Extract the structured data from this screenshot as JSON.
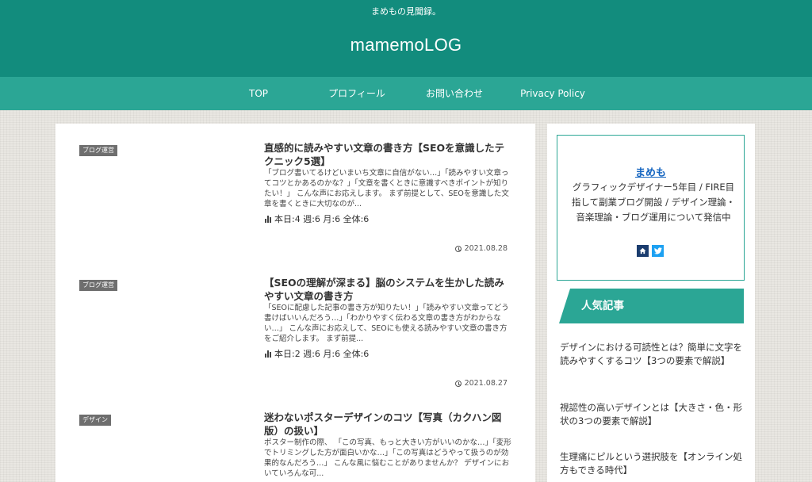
{
  "header": {
    "tagline": "まめもの見聞録。",
    "site_title": "mamemoLOG"
  },
  "nav": {
    "items": [
      {
        "label": "TOP"
      },
      {
        "label": "プロフィール"
      },
      {
        "label": "お問い合わせ"
      },
      {
        "label": "Privacy Policy"
      }
    ]
  },
  "articles": [
    {
      "category": "ブログ運営",
      "title": "直感的に読みやすい文章の書き方【SEOを意識したテクニック5選】",
      "excerpt": "「ブログ書いてるけどいまいち文章に自信がない…」「読みやすい文章ってコツとかあるのかな？」「文章を書くときに意識すべきポイントが知りたい！」 こんな声にお応えします。 まず前提として、SEOを意識した文章を書くときに大切なのが...",
      "stats": "本日:4 週:6 月:6 全体:6",
      "date": "2021.08.28"
    },
    {
      "category": "ブログ運営",
      "title": "【SEOの理解が深まる】脳のシステムを生かした読みやすい文章の書き方",
      "excerpt": "「SEOに配慮した記事の書き方が知りたい！」「読みやすい文章ってどう書けばいいんだろう…」「わかりやすく伝わる文章の書き方がわからない…」 こんな声にお応えして、SEOにも使える読みやすい文章の書き方をご紹介します。 まず前提...",
      "stats": "本日:2 週:6 月:6 全体:6",
      "date": "2021.08.27"
    },
    {
      "category": "デザイン",
      "title": "迷わないポスターデザインのコツ【写真（カクハン図版）の扱い】",
      "excerpt": "ポスター制作の際、 「この写真、もっと大きい方がいいのかな…」「変形でトリミングした方が面白いかな…」「この写真はどうやって扱うのが効果的なんだろう…」 こんな風に悩むことがありませんか？ デザインにおいていろんな可...",
      "stats": "",
      "date": ""
    }
  ],
  "sidebar": {
    "profile": {
      "name": "まめも",
      "description": "グラフィックデザイナー5年目 / FIRE目指して副業ブログ開設 / デザイン理論・音楽理論・ブログ運用について発信中"
    },
    "popular_heading": "人気記事",
    "popular": [
      {
        "title": "デザインにおける可読性とは？簡単に文字を読みやすくするコツ【3つの要素で解説】"
      },
      {
        "title": "視認性の高いデザインとは【大きさ・色・形状の3つの要素で解説】"
      },
      {
        "title": "生理痛にピルという選択肢を【オンライン処方もできる時代】"
      }
    ]
  },
  "colors": {
    "header_bg": "#128c7d",
    "nav_bg": "#2ba695",
    "accent": "#2ba695",
    "link": "#1565c0"
  }
}
